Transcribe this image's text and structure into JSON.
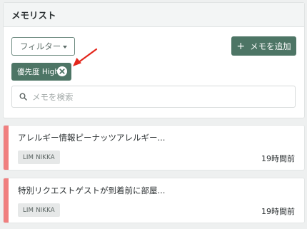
{
  "panel": {
    "title": "メモリスト",
    "filter_label": "フィルター",
    "add_button_plus": "+",
    "add_button_label": "メモを追加",
    "active_filter": "優先度 High",
    "search_placeholder": "メモを検索"
  },
  "memos": [
    {
      "title": "アレルギー情報ピーナッツアレルギー...",
      "tag": "LIM NIKKA",
      "time": "19時間前",
      "priority_color": "#f07f7f"
    },
    {
      "title": "特別リクエストゲストが到着前に部屋...",
      "tag": "LIM NIKKA",
      "time": "19時間前",
      "priority_color": "#f07f7f"
    }
  ],
  "colors": {
    "accent": "#4d7565",
    "priority_high": "#f07f7f",
    "annotation_arrow": "#e3261b"
  },
  "icons": {
    "filter_dropdown": "caret-down-icon",
    "chip_remove": "close-circle-icon",
    "search": "search-icon",
    "annotation": "red-arrow-annotation"
  }
}
